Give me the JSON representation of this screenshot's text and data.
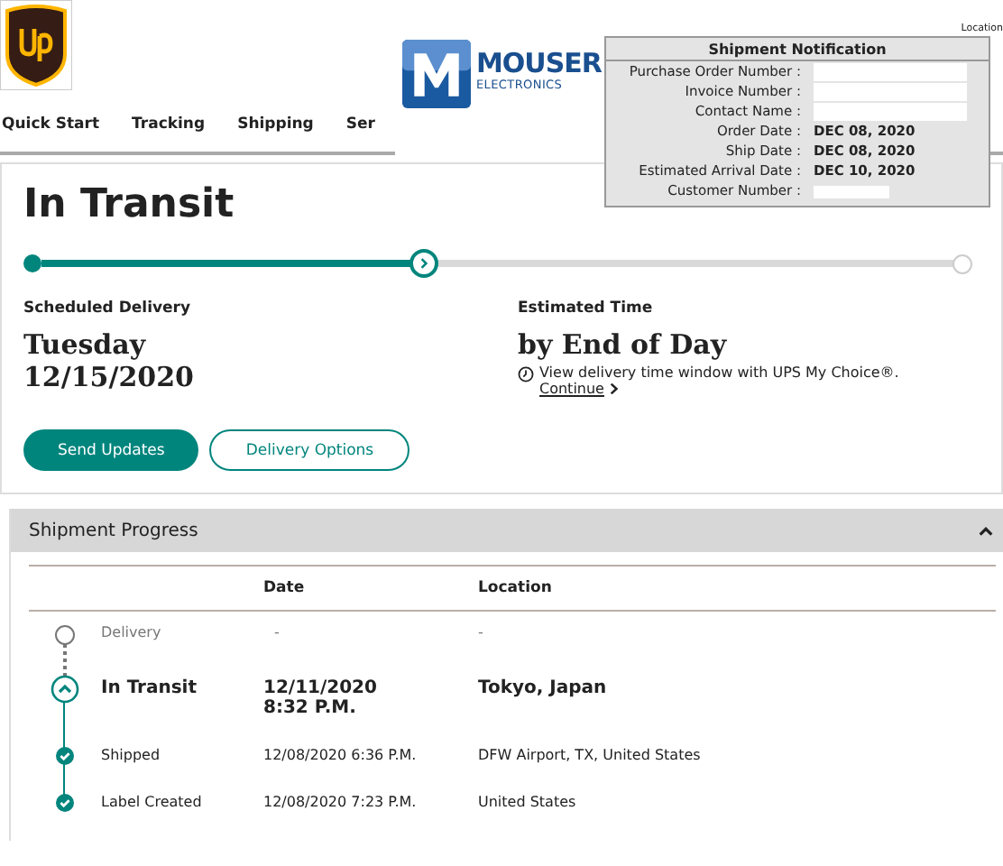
{
  "header": {
    "location_link": "Location",
    "nav": [
      "Quick Start",
      "Tracking",
      "Shipping",
      "Ser"
    ]
  },
  "overlay": {
    "logo_word": "MOUSER",
    "logo_sub": "ELECTRONICS",
    "notification": {
      "title": "Shipment Notification",
      "fields": [
        {
          "label": "Purchase Order Number :",
          "kind": "blank-tall"
        },
        {
          "label": "Invoice Number :",
          "kind": "blank-tall"
        },
        {
          "label": "Contact Name :",
          "kind": "blank-tall"
        },
        {
          "label": "Order Date :",
          "value": "DEC 08, 2020",
          "kind": "text"
        },
        {
          "label": "Ship Date :",
          "value": "DEC 08, 2020",
          "kind": "text"
        },
        {
          "label": "Estimated Arrival Date :",
          "value": "DEC 10, 2020",
          "kind": "text"
        },
        {
          "label": "Customer Number :",
          "kind": "blank-short"
        }
      ]
    }
  },
  "status": {
    "title": "In Transit",
    "level": 0.41,
    "scheduled_label": "Scheduled Delivery",
    "scheduled_day": "Tuesday",
    "scheduled_date": "12/15/2020",
    "estimated_label": "Estimated Time",
    "estimated_value": "by End of Day",
    "choice_note": "View delivery time window with UPS My Choice®.",
    "continue_link": "Continue",
    "buttons": [
      {
        "label": "Send Updates",
        "kind": "primary"
      },
      {
        "label": "Delivery Options",
        "kind": "outline"
      }
    ]
  },
  "progress": {
    "title": "Shipment Progress",
    "expanded": true,
    "columns": [
      "Date",
      "Location"
    ],
    "rows": [
      {
        "kind": "pending",
        "status": "Delivery",
        "date": "-",
        "location": "-"
      },
      {
        "kind": "current",
        "status": "In Transit",
        "date": "12/11/2020 8:32 P.M.",
        "location": "Tokyo, Japan"
      },
      {
        "kind": "done",
        "status": "Shipped",
        "date": "12/08/2020 6:36 P.M.",
        "location": "DFW Airport, TX, United States"
      },
      {
        "kind": "done",
        "status": "Label Created",
        "date": "12/08/2020 7:23 P.M.",
        "location": "United States"
      }
    ]
  }
}
